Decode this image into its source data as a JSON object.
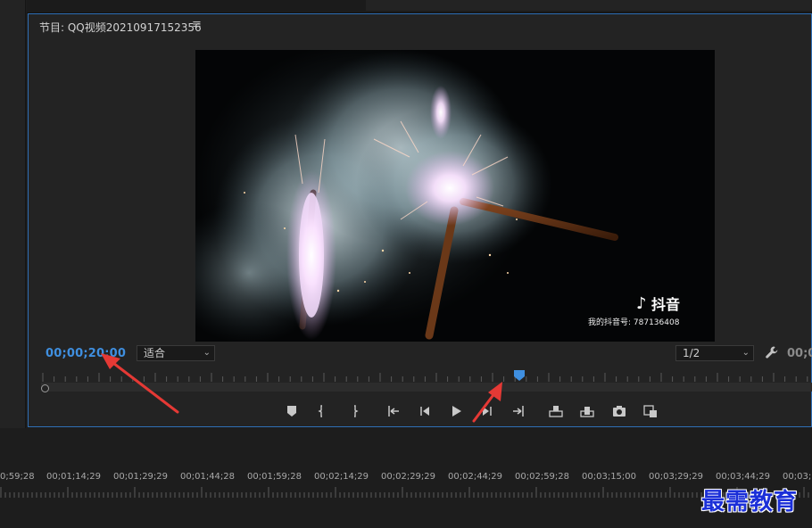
{
  "monitor": {
    "title": "节目: QQ视频20210917152356",
    "menu_glyph": "≡",
    "current_timecode": "00;00;20;00",
    "zoom_fit": "适合",
    "resolution": "1/2",
    "duration_timecode": "00;0",
    "playback_progress": 0.62
  },
  "video_overlay": {
    "brand": "抖音",
    "account_line": "我的抖音号: 787136408"
  },
  "transport": [
    {
      "name": "add-marker-button",
      "icon": "marker-icon"
    },
    {
      "name": "mark-in-button",
      "icon": "mark-in-icon"
    },
    {
      "name": "mark-out-button",
      "icon": "mark-out-icon"
    },
    {
      "name": "go-to-in-button",
      "icon": "go-to-in-icon"
    },
    {
      "name": "step-back-button",
      "icon": "step-back-icon"
    },
    {
      "name": "play-button",
      "icon": "play-icon"
    },
    {
      "name": "step-forward-button",
      "icon": "step-forward-icon"
    },
    {
      "name": "go-to-out-button",
      "icon": "go-to-out-icon"
    },
    {
      "name": "insert-button",
      "icon": "insert-icon"
    },
    {
      "name": "overwrite-button",
      "icon": "overwrite-icon"
    },
    {
      "name": "export-frame-button",
      "icon": "camera-icon"
    },
    {
      "name": "button-editor-button",
      "icon": "button-editor-icon"
    }
  ],
  "sequence_ruler": [
    "0;59;28",
    "00;01;14;29",
    "00;01;29;29",
    "00;01;44;28",
    "00;01;59;28",
    "00;02;14;29",
    "00;02;29;29",
    "00;02;44;29",
    "00;02;59;28",
    "00;03;15;00",
    "00;03;29;29",
    "00;03;44;29",
    "00;03;"
  ],
  "watermark": "最需教育",
  "colors": {
    "accent": "#3f8fe0",
    "panel_border": "#2f6fb6",
    "annotation_arrow": "#e53935",
    "watermark": "#1b2fd8"
  }
}
